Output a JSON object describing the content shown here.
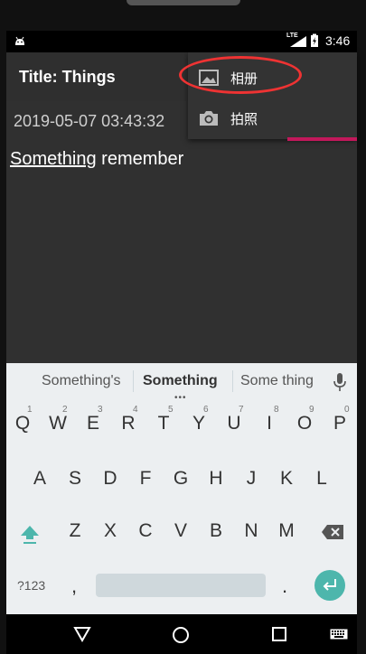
{
  "status_bar": {
    "time": "3:46",
    "network": "LTE"
  },
  "toolbar": {
    "title": "Title: Things"
  },
  "content": {
    "date": "2019-05-07 03:43:32",
    "note_underlined_word": "Something",
    "note_rest": " remember"
  },
  "popup_menu": {
    "items": [
      {
        "label": "相册",
        "icon": "image-icon"
      },
      {
        "label": "拍照",
        "icon": "camera-icon"
      }
    ]
  },
  "keyboard": {
    "suggestions": [
      "Something's",
      "Something",
      "Some thing"
    ],
    "row1": [
      "Q",
      "W",
      "E",
      "R",
      "T",
      "Y",
      "U",
      "I",
      "O",
      "P"
    ],
    "row1_hints": [
      "1",
      "2",
      "3",
      "4",
      "5",
      "6",
      "7",
      "8",
      "9",
      "0"
    ],
    "row2": [
      "A",
      "S",
      "D",
      "F",
      "G",
      "H",
      "J",
      "K",
      "L"
    ],
    "row3": [
      "Z",
      "X",
      "C",
      "V",
      "B",
      "N",
      "M"
    ],
    "symbols_key": "?123",
    "comma_key": ",",
    "period_key": "."
  },
  "colors": {
    "accent": "#c2185b",
    "enter_key": "#4db6ac",
    "annotation": "#e33333"
  }
}
